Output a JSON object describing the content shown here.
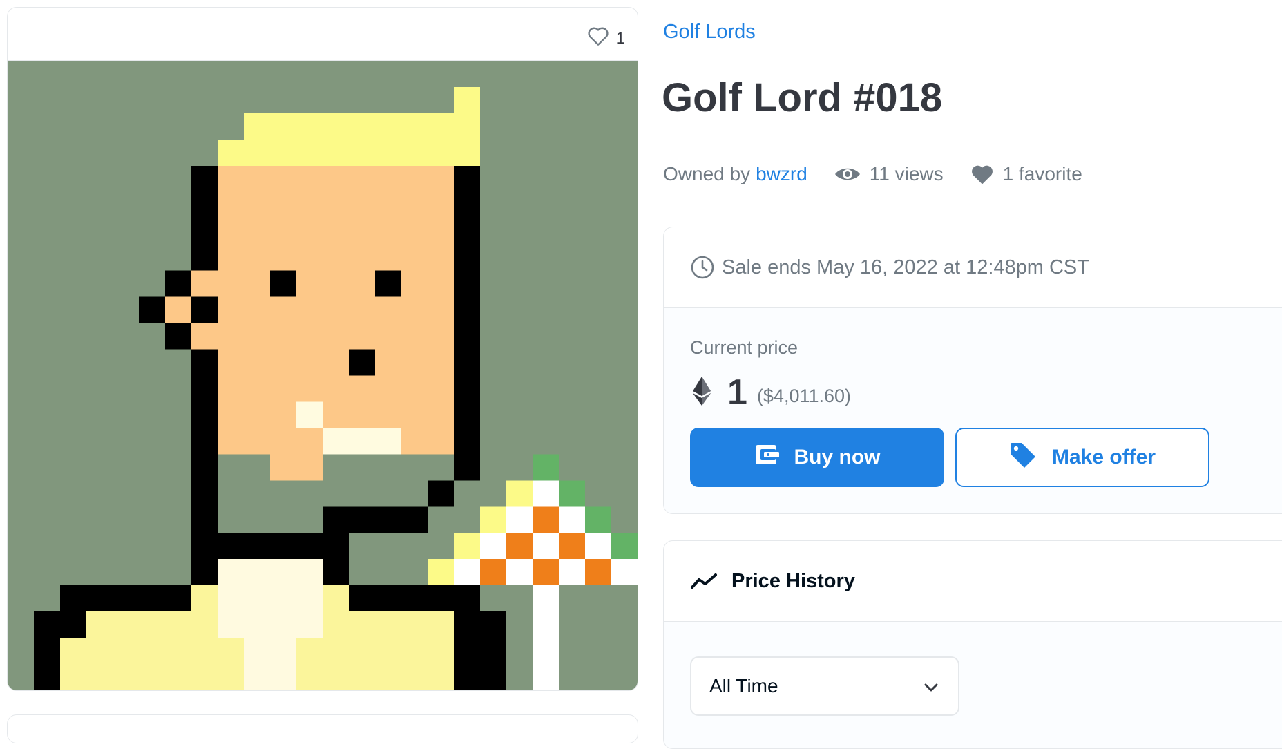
{
  "asset": {
    "favorite_count": "1",
    "image_alt": "Golf Lord #018 pixel art"
  },
  "details": {
    "collection": "Golf Lords",
    "title": "Golf Lord #018",
    "owned_by_label": "Owned by",
    "owner": "bwzrd",
    "views": "11 views",
    "favorites": "1 favorite"
  },
  "sale": {
    "ends_text": "Sale ends May 16, 2022 at 12:48pm CST",
    "current_price_label": "Current price",
    "price_eth": "1",
    "price_usd": "($4,011.60)",
    "buy_label": "Buy now",
    "offer_label": "Make offer"
  },
  "price_history": {
    "title": "Price History",
    "range_selected": "All Time"
  },
  "colors": {
    "accent": "#2081e2",
    "background_art": "#81977d",
    "skin": "#fdc888",
    "hair": "#fcfa88",
    "shirt": "#fbf59b",
    "flag_orange": "#ef7f1a",
    "flag_green": "#63b366"
  },
  "icons": {
    "favorite": "heart-outline-icon",
    "views": "eye-icon",
    "favorites": "heart-filled-icon",
    "sale": "clock-icon",
    "currency": "ethereum-icon",
    "buy": "wallet-icon",
    "offer": "tag-icon",
    "history": "trend-line-icon",
    "dropdown": "chevron-down-icon"
  }
}
